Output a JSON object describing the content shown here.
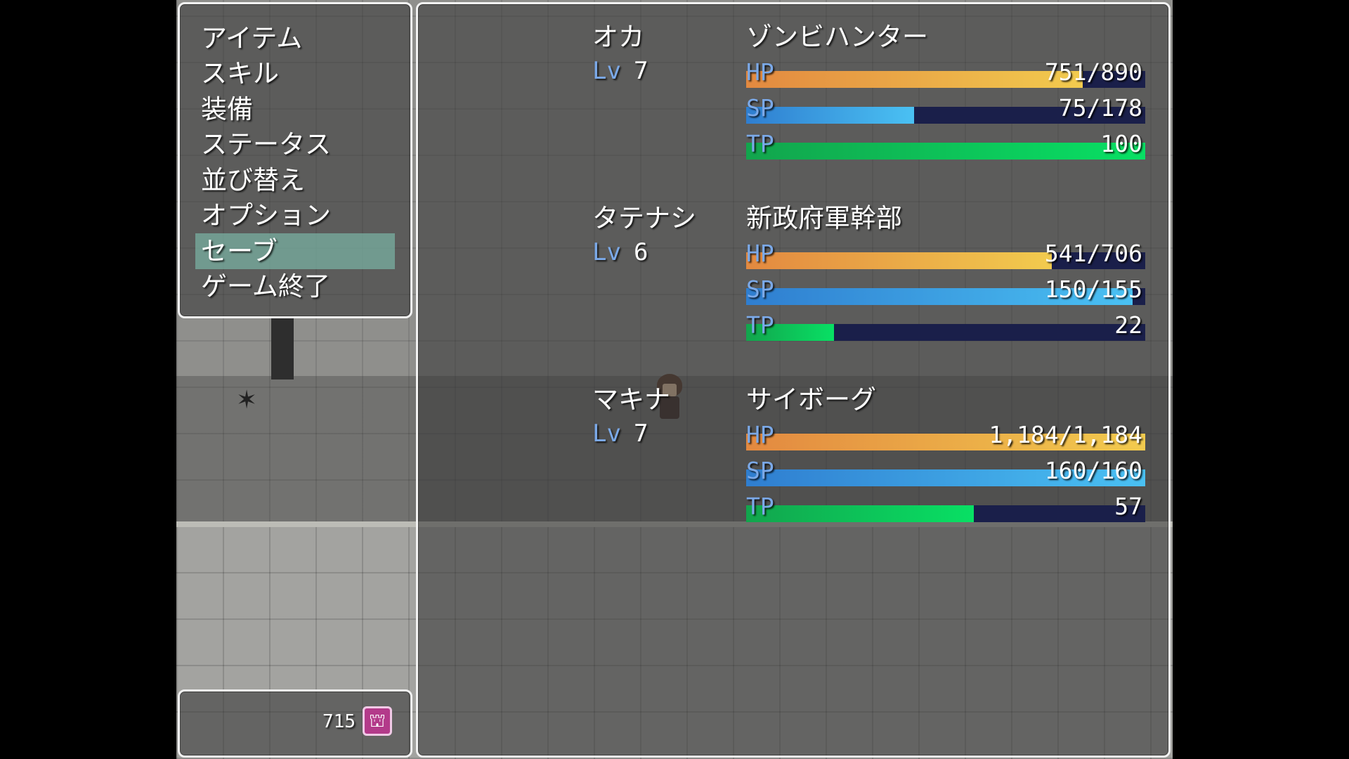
{
  "menu": {
    "commands": [
      {
        "label": "アイテム"
      },
      {
        "label": "スキル"
      },
      {
        "label": "装備"
      },
      {
        "label": "ステータス"
      },
      {
        "label": "並び替え"
      },
      {
        "label": "オプション"
      },
      {
        "label": "セーブ",
        "selected": true
      },
      {
        "label": "ゲーム終了"
      }
    ],
    "selected_index": 6
  },
  "gold": {
    "value": "715",
    "icon": "currency-icon"
  },
  "party": [
    {
      "name": "オカ",
      "class": "ゾンビハンター",
      "level_label": "Lv",
      "level": "7",
      "hp": {
        "label": "HP",
        "text": "751/890",
        "fill": 0.844
      },
      "sp": {
        "label": "SP",
        "text": "75/178",
        "fill": 0.421
      },
      "tp": {
        "label": "TP",
        "text": "100",
        "fill": 1.0
      }
    },
    {
      "name": "タテナシ",
      "class": "新政府軍幹部",
      "level_label": "Lv",
      "level": "6",
      "hp": {
        "label": "HP",
        "text": "541/706",
        "fill": 0.766
      },
      "sp": {
        "label": "SP",
        "text": "150/155",
        "fill": 0.968
      },
      "tp": {
        "label": "TP",
        "text": "22",
        "fill": 0.22
      }
    },
    {
      "name": "マキナ",
      "class": "サイボーグ",
      "level_label": "Lv",
      "level": "7",
      "hp": {
        "label": "HP",
        "text": "1,184/1,184",
        "fill": 1.0
      },
      "sp": {
        "label": "SP",
        "text": "160/160",
        "fill": 1.0
      },
      "tp": {
        "label": "TP",
        "text": "57",
        "fill": 0.57
      }
    }
  ],
  "colors": {
    "hp_gauge": [
      "#e38940",
      "#f2cb4e"
    ],
    "sp_gauge": [
      "#2f7ed0",
      "#4ac1f3"
    ],
    "tp_gauge": [
      "#12a54d",
      "#08e064"
    ],
    "gauge_back": "#1a1f4a",
    "system_label": "#7ba9e8",
    "selection": "#78afa0"
  }
}
